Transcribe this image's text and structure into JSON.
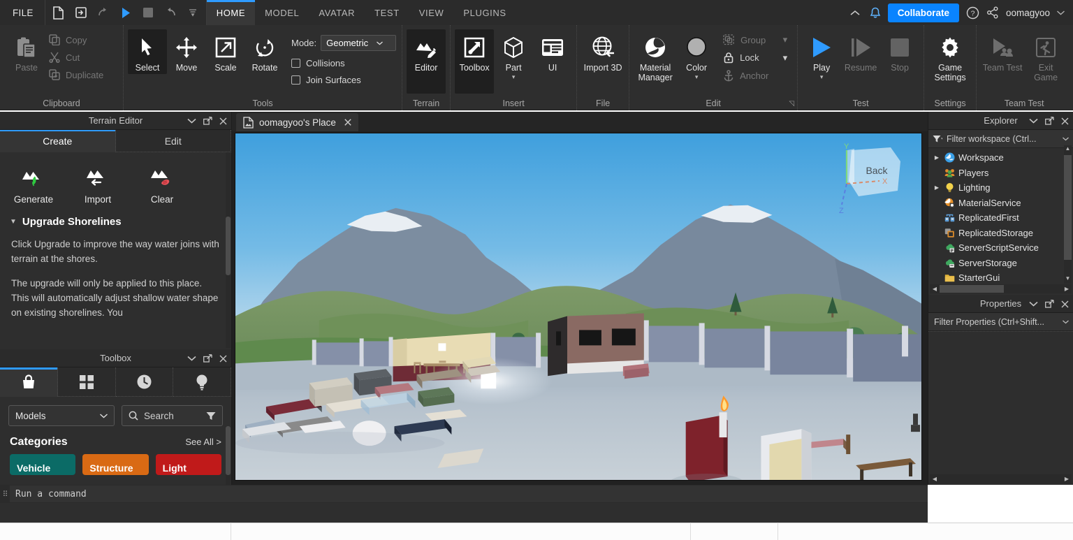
{
  "app": {
    "title": "Roblox Studio",
    "username": "oomagyoo"
  },
  "titlebar": {
    "file_menu": "FILE",
    "quick_access": [
      {
        "name": "new-file-icon",
        "label": "New"
      },
      {
        "name": "open-file-icon",
        "label": "Open"
      },
      {
        "name": "redo-icon",
        "label": "Redo"
      },
      {
        "name": "play-icon",
        "label": "Play"
      },
      {
        "name": "stop-icon",
        "label": "Stop"
      },
      {
        "name": "undo-icon",
        "label": "Undo"
      },
      {
        "name": "customize-caret-icon",
        "label": "Customize"
      }
    ],
    "tabs": [
      {
        "label": "HOME",
        "active": true
      },
      {
        "label": "MODEL",
        "active": false
      },
      {
        "label": "AVATAR",
        "active": false
      },
      {
        "label": "TEST",
        "active": false
      },
      {
        "label": "VIEW",
        "active": false
      },
      {
        "label": "PLUGINS",
        "active": false
      }
    ],
    "collaborate_label": "Collaborate",
    "help_icon": "help-circle-icon",
    "share_icon": "share-nodes-icon",
    "notifications_icon": "bell-icon",
    "collapse_icon": "chevron-up-icon",
    "accent_color": "#0a84ff"
  },
  "ribbon": {
    "groups": [
      {
        "label": "Clipboard",
        "big_buttons": [
          {
            "label": "Paste",
            "icon": "paste-icon",
            "disabled": true
          }
        ],
        "small_buttons": [
          {
            "label": "Copy",
            "icon": "copy-icon",
            "disabled": true
          },
          {
            "label": "Cut",
            "icon": "cut-icon",
            "disabled": true
          },
          {
            "label": "Duplicate",
            "icon": "duplicate-icon",
            "disabled": true
          }
        ]
      },
      {
        "label": "Tools",
        "big_buttons": [
          {
            "label": "Select",
            "icon": "cursor-arrow-icon",
            "active": true
          },
          {
            "label": "Move",
            "icon": "move-arrows-icon"
          },
          {
            "label": "Scale",
            "icon": "scale-icon"
          },
          {
            "label": "Rotate",
            "icon": "rotate-icon"
          }
        ],
        "mode_label": "Mode:",
        "mode_value": "Geometric",
        "checkboxes": [
          {
            "label": "Collisions",
            "checked": false
          },
          {
            "label": "Join Surfaces",
            "checked": false
          }
        ]
      },
      {
        "label": "Terrain",
        "big_buttons": [
          {
            "label": "Editor",
            "icon": "terrain-editor-icon",
            "active": true
          }
        ]
      },
      {
        "label": "Insert",
        "big_buttons": [
          {
            "label": "Toolbox",
            "icon": "toolbox-icon",
            "active": true
          },
          {
            "label": "Part",
            "icon": "cube-icon",
            "caret": true
          },
          {
            "label": "UI",
            "icon": "ui-panel-icon"
          }
        ]
      },
      {
        "label": "File",
        "big_buttons": [
          {
            "label": "Import 3D",
            "icon": "import-3d-globe-icon"
          }
        ]
      },
      {
        "label": "Edit",
        "big_buttons": [
          {
            "label": "Material Manager",
            "icon": "material-sphere-icon"
          },
          {
            "label": "Color",
            "icon": "color-swatch-icon",
            "caret": true
          }
        ],
        "small_buttons": [
          {
            "label": "Group",
            "icon": "group-icon",
            "disabled": true,
            "caret": true
          },
          {
            "label": "Lock",
            "icon": "lock-icon",
            "disabled": false,
            "caret": true
          },
          {
            "label": "Anchor",
            "icon": "anchor-icon",
            "disabled": true
          }
        ],
        "dialog_launcher": true
      },
      {
        "label": "Test",
        "big_buttons": [
          {
            "label": "Play",
            "icon": "play-triangle-icon",
            "caret": true
          },
          {
            "label": "Resume",
            "icon": "resume-icon",
            "disabled": true
          },
          {
            "label": "Stop",
            "icon": "stop-square-icon",
            "disabled": true
          }
        ]
      },
      {
        "label": "Settings",
        "big_buttons": [
          {
            "label": "Game Settings",
            "icon": "gear-icon"
          }
        ]
      },
      {
        "label": "Team Test",
        "big_buttons": [
          {
            "label": "Team Test",
            "icon": "team-test-icon",
            "disabled": true
          },
          {
            "label": "Exit Game",
            "icon": "exit-game-icon",
            "disabled": true
          }
        ]
      }
    ]
  },
  "terrain_editor": {
    "title": "Terrain Editor",
    "tabs": [
      {
        "label": "Create",
        "active": true
      },
      {
        "label": "Edit",
        "active": false
      }
    ],
    "tools": [
      {
        "label": "Generate",
        "icon": "terrain-generate-icon"
      },
      {
        "label": "Import",
        "icon": "terrain-import-icon"
      },
      {
        "label": "Clear",
        "icon": "terrain-clear-icon"
      }
    ],
    "section_title": "Upgrade Shorelines",
    "paragraphs": [
      "Click Upgrade to improve the way water joins with terrain at the shores.",
      "The upgrade will only be applied to this place. This will automatically adjust shallow water shape on existing shorelines. You"
    ],
    "window_buttons": [
      "chevron-down-icon",
      "undock-icon",
      "close-icon"
    ]
  },
  "toolbox": {
    "title": "Toolbox",
    "tabs": [
      {
        "icon": "marketplace-bag-icon",
        "active": true
      },
      {
        "icon": "inventory-grid-icon",
        "active": false
      },
      {
        "icon": "recent-clock-icon",
        "active": false
      },
      {
        "icon": "creations-bulb-icon",
        "active": false
      }
    ],
    "filter_value": "Models",
    "search_placeholder": "Search",
    "search_icon": "magnifier-icon",
    "filter_icon": "funnel-icon",
    "categories_title": "Categories",
    "see_all_label": "See All >",
    "category_chips": [
      {
        "label": "Vehicle",
        "color": "#0b6b66"
      },
      {
        "label": "Structure",
        "color": "#d96a14"
      },
      {
        "label": "Light",
        "color": "#c01a1a"
      }
    ],
    "window_buttons": [
      "chevron-down-icon",
      "undock-icon",
      "close-icon"
    ]
  },
  "viewport": {
    "tab_label": "oomagyoo's Place",
    "tab_icon": "place-file-icon",
    "tab_close_icon": "close-icon",
    "gizmo": {
      "face_label": "Back",
      "axis_x": "X",
      "axis_y": "Y",
      "axis_z": "Z",
      "axis_x_color": "#d98b6a",
      "axis_y_color": "#7ed87e",
      "axis_z_color": "#5a7fe0"
    },
    "scene": {
      "description": "3D baseplate scene with mountains, trees, brick house, walls, colored part blocks, table and chairs, door and fire part",
      "sky_top": "#4ba7e0",
      "sky_bottom": "#bfe0f2",
      "ground": "#b9c3cd"
    }
  },
  "explorer": {
    "title": "Explorer",
    "filter_placeholder": "Filter workspace (Ctrl...",
    "filter_icon": "funnel-icon",
    "items": [
      {
        "label": "Workspace",
        "icon": "workspace-icon",
        "color": "#3aa0e8",
        "expandable": true
      },
      {
        "label": "Players",
        "icon": "players-icon",
        "color": "#e08a2b",
        "expandable": false
      },
      {
        "label": "Lighting",
        "icon": "lighting-icon",
        "color": "#f2d24b",
        "expandable": true
      },
      {
        "label": "MaterialService",
        "icon": "material-service-icon",
        "color": "#e8922b",
        "expandable": false
      },
      {
        "label": "ReplicatedFirst",
        "icon": "replicated-first-icon",
        "color": "#5b9bd5",
        "expandable": false
      },
      {
        "label": "ReplicatedStorage",
        "icon": "replicated-storage-icon",
        "color": "#d98a2b",
        "expandable": false
      },
      {
        "label": "ServerScriptService",
        "icon": "server-script-service-icon",
        "color": "#3fa85f",
        "expandable": false
      },
      {
        "label": "ServerStorage",
        "icon": "server-storage-icon",
        "color": "#3fa85f",
        "expandable": false
      },
      {
        "label": "StarterGui",
        "icon": "starter-gui-icon",
        "color": "#e0b23a",
        "expandable": false
      }
    ],
    "window_buttons": [
      "chevron-down-icon",
      "undock-icon",
      "close-icon"
    ]
  },
  "properties": {
    "title": "Properties",
    "filter_placeholder": "Filter Properties (Ctrl+Shift...",
    "window_buttons": [
      "chevron-down-icon",
      "undock-icon",
      "close-icon"
    ]
  },
  "command_bar": {
    "placeholder": "Run a command",
    "grip_icon": "drag-grip-icon"
  }
}
